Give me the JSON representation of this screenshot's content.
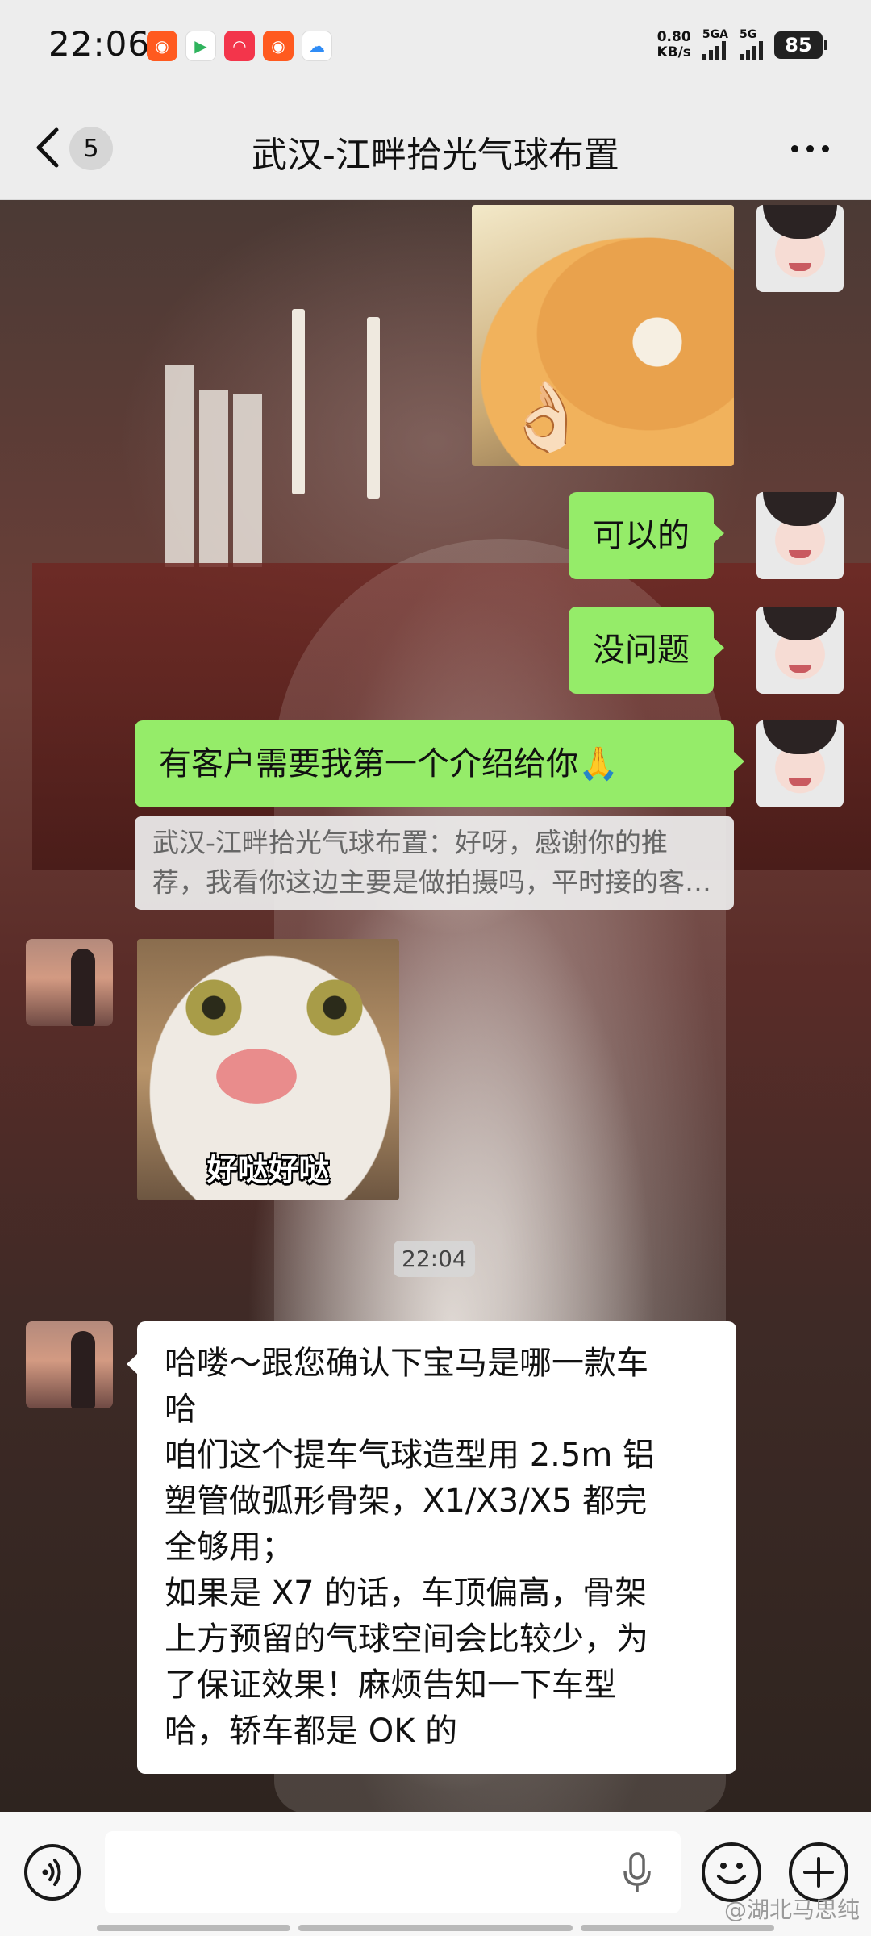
{
  "status_bar": {
    "time": "22:06",
    "apps": [
      {
        "icon": "kuaishou-icon",
        "glyph": "◉",
        "color": "#ff5a1f"
      },
      {
        "icon": "play-store-icon",
        "glyph": "▶",
        "color": "#2fb35d"
      },
      {
        "icon": "red-app-icon",
        "glyph": "◠",
        "color": "#f3354b"
      },
      {
        "icon": "kuaishou-icon",
        "glyph": "◉",
        "color": "#ff5a1f"
      },
      {
        "icon": "cloud-app-icon",
        "glyph": "☁",
        "color": "#2f8cf6"
      }
    ],
    "speed_value": "0.80",
    "speed_unit": "KB/s",
    "signal_1": "5GA",
    "signal_2": "5G",
    "battery": "85"
  },
  "header": {
    "back_label": "back",
    "unread_count": "5",
    "title": "武汉-江畔拾光气球布置",
    "more_label": "more"
  },
  "messages": {
    "m2": "可以的",
    "m3": "没问题",
    "m4": "有客户需要我第一个介绍给你🙏",
    "quote": "武汉-江畔拾光气球布置：好呀，感谢你的推荐，我看你这边主要是做拍摄吗，平时接的客户多吗",
    "sticker_caption": "好哒好哒",
    "timestamp": "22:04",
    "long_lines": [
      "哈喽～跟您确认下宝马是哪一款车",
      "哈",
      "咱们这个提车气球造型用 2.5m 铝",
      "塑管做弧形骨架，X1/X3/X5 都完",
      "全够用；",
      "如果是 X7 的话，车顶偏高，骨架",
      "上方预留的气球空间会比较少，为",
      "了保证效果！麻烦告知一下车型",
      "哈，轿车都是 OK 的"
    ]
  },
  "stickers": {
    "cat1_emoji": "👌🏻"
  },
  "input_bar": {
    "placeholder": ""
  },
  "watermark": "@湖北马思纯",
  "colors": {
    "my_bubble": "#95ec69",
    "their_bubble": "#ffffff",
    "bar_bg": "#ededed"
  }
}
